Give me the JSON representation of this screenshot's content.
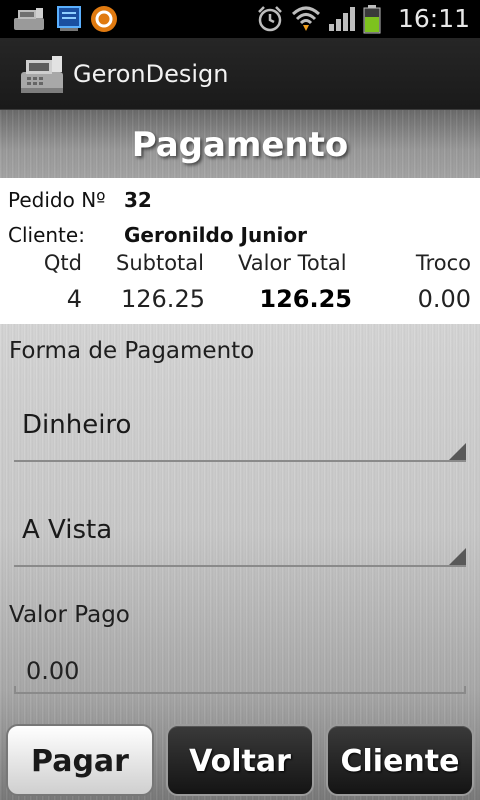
{
  "status_bar": {
    "time": "16:11",
    "icons": [
      "cash-register-icon",
      "monitor-icon",
      "avast-icon",
      "alarm-icon",
      "wifi-icon",
      "signal-icon",
      "battery-icon"
    ]
  },
  "action_bar": {
    "app_title": "GeronDesign",
    "logo_icon": "cash-register-icon"
  },
  "page": {
    "title": "Pagamento"
  },
  "order": {
    "number_label": "Pedido Nº",
    "number": "32",
    "client_label": "Cliente:",
    "client_name": "Geronildo Junior",
    "headers": {
      "qty": "Qtd",
      "subtotal": "Subtotal",
      "total": "Valor Total",
      "change": "Troco"
    },
    "values": {
      "qty": "4",
      "subtotal": "126.25",
      "total": "126.25",
      "change": "0.00"
    }
  },
  "payment": {
    "method_label": "Forma de Pagamento",
    "method_value": "Dinheiro",
    "terms_value": "A Vista",
    "paid_label": "Valor Pago",
    "paid_value": "0.00"
  },
  "buttons": {
    "pay": "Pagar",
    "back": "Voltar",
    "client": "Cliente"
  },
  "colors": {
    "battery": "#7dc21e",
    "wifi_arrow": "#f0a020",
    "metal_light": "#d6d6d6"
  }
}
